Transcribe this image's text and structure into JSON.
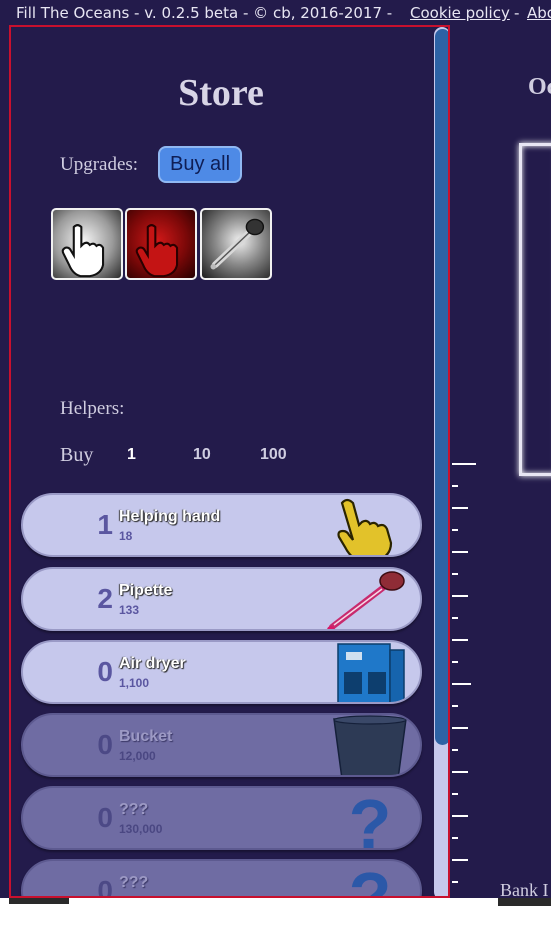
{
  "topbar": {
    "title": "Fill The Oceans - v. 0.2.5 beta - © cb, 2016-2017 -",
    "cookie_link": "Cookie policy",
    "sep": "-",
    "about_link": "Abo"
  },
  "store": {
    "title": "Store",
    "upgrades_label": "Upgrades:",
    "buy_all_label": "Buy all",
    "upgrades": [
      {
        "icon": "hand-pointer-icon",
        "style": "white"
      },
      {
        "icon": "hand-pointer-icon",
        "style": "red"
      },
      {
        "icon": "pipette-icon",
        "style": "gray"
      }
    ],
    "helpers_label": "Helpers:",
    "buy_label": "Buy",
    "buy_options": [
      "1",
      "10",
      "100"
    ],
    "helpers": [
      {
        "count": "1",
        "name": "Helping hand",
        "cost": "18",
        "icon": "hand-icon",
        "enabled": true
      },
      {
        "count": "2",
        "name": "Pipette",
        "cost": "133",
        "icon": "pipette-icon",
        "enabled": true
      },
      {
        "count": "0",
        "name": "Air dryer",
        "cost": "1,100",
        "icon": "air-dryer-icon",
        "enabled": true
      },
      {
        "count": "0",
        "name": "Bucket",
        "cost": "12,000",
        "icon": "bucket-icon",
        "enabled": false
      },
      {
        "count": "0",
        "name": "???",
        "cost": "130,000",
        "icon": "question-icon",
        "enabled": false
      },
      {
        "count": "0",
        "name": "???",
        "cost": "",
        "icon": "question-icon",
        "enabled": false
      }
    ]
  },
  "ocean": {
    "title": "Oc",
    "bank_label": "Bank I"
  }
}
